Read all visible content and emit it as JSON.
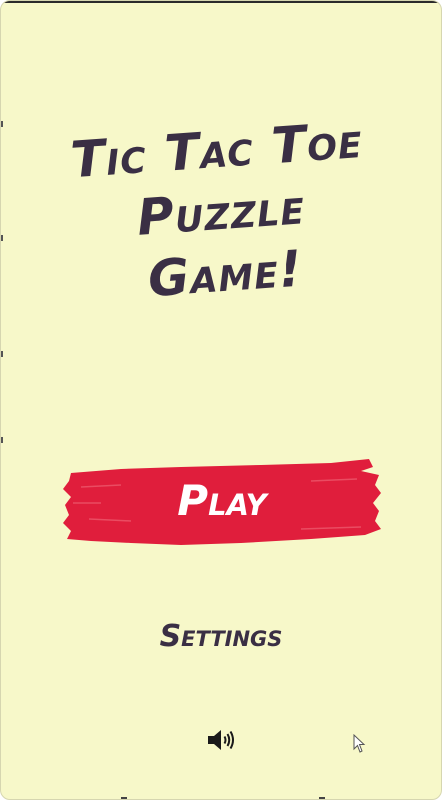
{
  "game": {
    "title_lines": [
      "Tic Tac Toe",
      "Puzzle",
      "Game!"
    ],
    "play_label": "Play",
    "settings_label": "Settings"
  },
  "icons": {
    "sound": "speaker-volume-icon",
    "cursor": "mouse-pointer-icon"
  },
  "colors": {
    "background": "#f7f8c9",
    "title_text": "#3a2f44",
    "play_brush": "#e01e3c",
    "play_text": "#ffffff"
  }
}
